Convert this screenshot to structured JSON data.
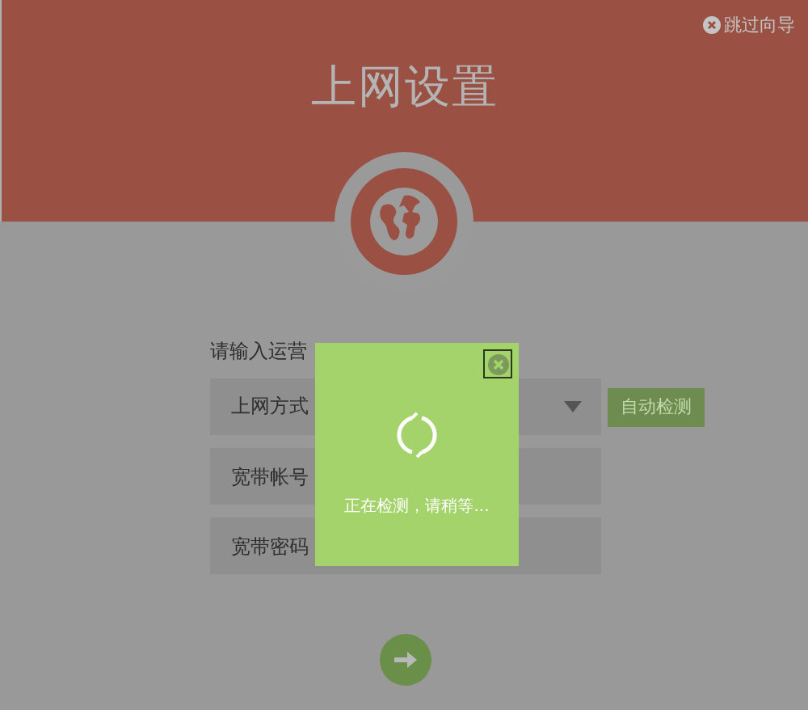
{
  "header": {
    "title": "上网设置",
    "skip_link": "跳过向导"
  },
  "form": {
    "prompt": "请输入运营",
    "select": {
      "placeholder": "上网方式"
    },
    "detect_button": "自动检测",
    "fields": [
      {
        "placeholder": "宽带帐号"
      },
      {
        "placeholder": "宽带密码"
      }
    ]
  },
  "dialog": {
    "message": "正在检测，请稍等..."
  }
}
